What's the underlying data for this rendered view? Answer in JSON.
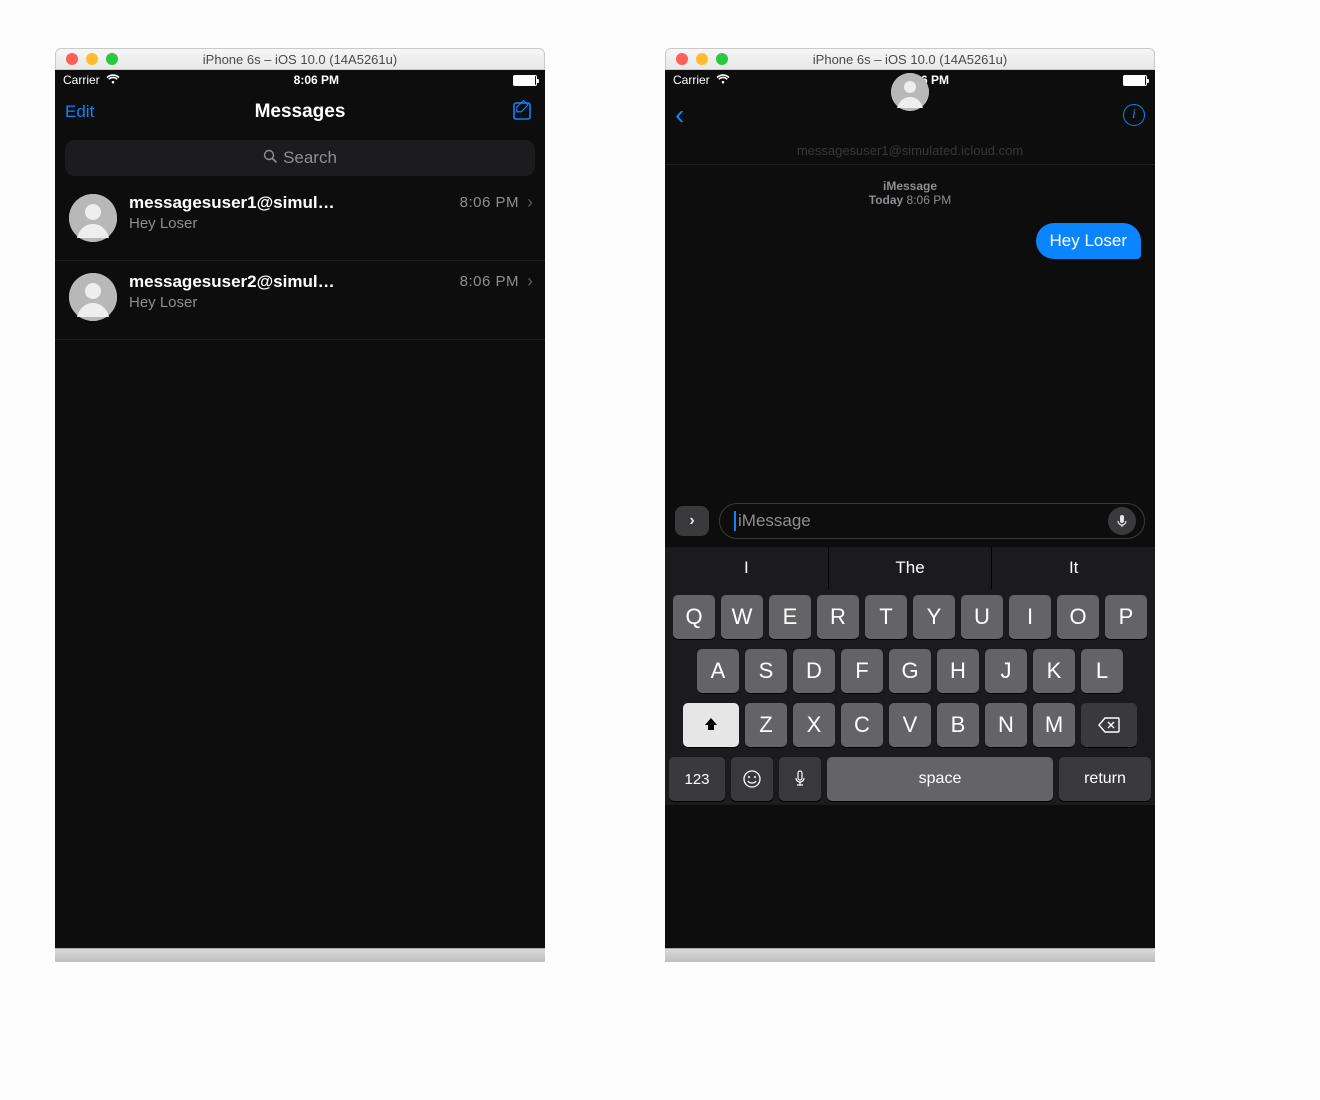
{
  "window_title": "iPhone 6s – iOS 10.0 (14A5261u)",
  "statusbar": {
    "carrier": "Carrier",
    "time": "8:06 PM"
  },
  "left": {
    "nav": {
      "edit": "Edit",
      "title": "Messages"
    },
    "search_placeholder": "Search",
    "conversations": [
      {
        "name": "messagesuser1@simul…",
        "time": "8:06 PM",
        "preview": "Hey Loser"
      },
      {
        "name": "messagesuser2@simul…",
        "time": "8:06 PM",
        "preview": "Hey Loser"
      }
    ]
  },
  "right": {
    "recipient": "messagesuser1@simulated.icloud.com",
    "stamp": {
      "service": "iMessage",
      "day": "Today",
      "time": "8:06 PM"
    },
    "bubble": "Hey Loser",
    "input_placeholder": "iMessage",
    "predictions": [
      "I",
      "The",
      "It"
    ],
    "keyboard": {
      "row1": [
        "Q",
        "W",
        "E",
        "R",
        "T",
        "Y",
        "U",
        "I",
        "O",
        "P"
      ],
      "row2": [
        "A",
        "S",
        "D",
        "F",
        "G",
        "H",
        "J",
        "K",
        "L"
      ],
      "row3": [
        "Z",
        "X",
        "C",
        "V",
        "B",
        "N",
        "M"
      ],
      "nums": "123",
      "space": "space",
      "ret": "return"
    }
  }
}
